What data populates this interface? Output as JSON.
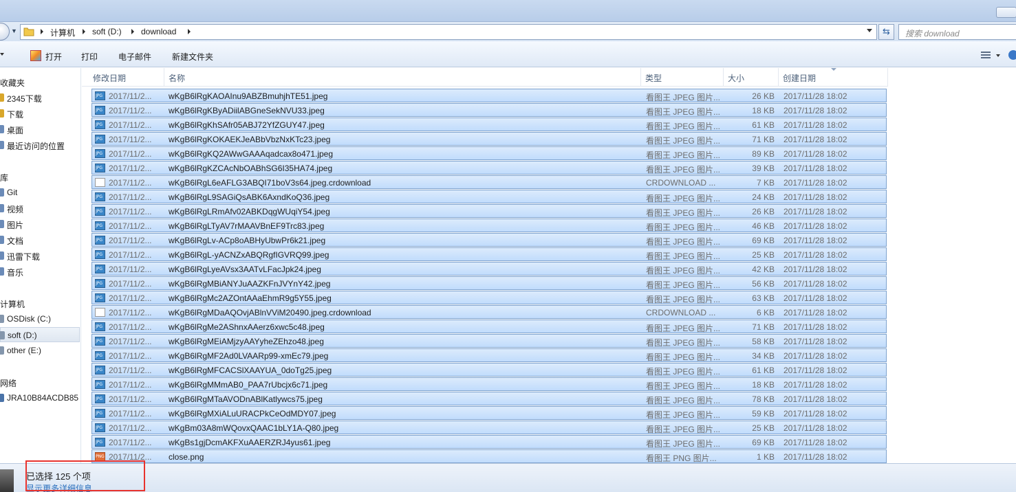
{
  "address": {
    "crumbs": [
      "计算机",
      "soft (D:)",
      "download"
    ],
    "search_placeholder": "搜索 download"
  },
  "toolbar": {
    "open": "打开",
    "print": "打印",
    "email": "电子邮件",
    "new_folder": "新建文件夹"
  },
  "sidebar": {
    "favorites": {
      "title": "收藏夹",
      "items": [
        {
          "label": "2345下载"
        },
        {
          "label": "下载"
        },
        {
          "label": "桌面"
        },
        {
          "label": "最近访问的位置"
        }
      ]
    },
    "libraries": {
      "title": "库",
      "items": [
        {
          "label": "Git"
        },
        {
          "label": "视频"
        },
        {
          "label": "图片"
        },
        {
          "label": "文档"
        },
        {
          "label": "迅雷下载"
        },
        {
          "label": "音乐"
        }
      ]
    },
    "computer": {
      "title": "计算机",
      "items": [
        {
          "label": "OSDisk (C:)"
        },
        {
          "label": "soft (D:)",
          "selected": true
        },
        {
          "label": "other (E:)"
        }
      ]
    },
    "network": {
      "title": "网络",
      "items": [
        {
          "label": "JRA10B84ACDB85"
        }
      ]
    }
  },
  "columns": {
    "modified": "修改日期",
    "name": "名称",
    "type": "类型",
    "size": "大小",
    "created": "创建日期"
  },
  "files": [
    {
      "icon": "jpg",
      "modified": "2017/11/2...",
      "name": "wKgB6lRgKAOAInu9ABZBmuhjhTE51.jpeg",
      "type": "看图王 JPEG 图片...",
      "size": "26 KB",
      "created": "2017/11/28 18:02"
    },
    {
      "icon": "jpg",
      "modified": "2017/11/2...",
      "name": "wKgB6lRgKByADiilABGneSekNVU33.jpeg",
      "type": "看图王 JPEG 图片...",
      "size": "18 KB",
      "created": "2017/11/28 18:02"
    },
    {
      "icon": "jpg",
      "modified": "2017/11/2...",
      "name": "wKgB6lRgKhSAfr05ABJ72YfZGUY47.jpeg",
      "type": "看图王 JPEG 图片...",
      "size": "61 KB",
      "created": "2017/11/28 18:02"
    },
    {
      "icon": "jpg",
      "modified": "2017/11/2...",
      "name": "wKgB6lRgKOKAEKJeABbVbzNxKTc23.jpeg",
      "type": "看图王 JPEG 图片...",
      "size": "71 KB",
      "created": "2017/11/28 18:02"
    },
    {
      "icon": "jpg",
      "modified": "2017/11/2...",
      "name": "wKgB6lRgKQ2AWwGAAAqadcax8o471.jpeg",
      "type": "看图王 JPEG 图片...",
      "size": "89 KB",
      "created": "2017/11/28 18:02"
    },
    {
      "icon": "jpg",
      "modified": "2017/11/2...",
      "name": "wKgB6lRgKZCAcNbOABhSG6I35HA74.jpeg",
      "type": "看图王 JPEG 图片...",
      "size": "39 KB",
      "created": "2017/11/28 18:02"
    },
    {
      "icon": "blank",
      "modified": "2017/11/2...",
      "name": "wKgB6lRgL6eAFLG3ABQI71boV3s64.jpeg.crdownload",
      "type": "CRDOWNLOAD ...",
      "size": "7 KB",
      "created": "2017/11/28 18:02"
    },
    {
      "icon": "jpg",
      "modified": "2017/11/2...",
      "name": "wKgB6lRgL9SAGiQsABK6AxndKoQ36.jpeg",
      "type": "看图王 JPEG 图片...",
      "size": "24 KB",
      "created": "2017/11/28 18:02"
    },
    {
      "icon": "jpg",
      "modified": "2017/11/2...",
      "name": "wKgB6lRgLRmAfv02ABKDqgWUqiY54.jpeg",
      "type": "看图王 JPEG 图片...",
      "size": "26 KB",
      "created": "2017/11/28 18:02"
    },
    {
      "icon": "jpg",
      "modified": "2017/11/2...",
      "name": "wKgB6lRgLTyAV7rMAAVBnEF9Trc83.jpeg",
      "type": "看图王 JPEG 图片...",
      "size": "46 KB",
      "created": "2017/11/28 18:02"
    },
    {
      "icon": "jpg",
      "modified": "2017/11/2...",
      "name": "wKgB6lRgLv-ACp8oABHyUbwPr6k21.jpeg",
      "type": "看图王 JPEG 图片...",
      "size": "69 KB",
      "created": "2017/11/28 18:02"
    },
    {
      "icon": "jpg",
      "modified": "2017/11/2...",
      "name": "wKgB6lRgL-yACNZxABQRgfIGVRQ99.jpeg",
      "type": "看图王 JPEG 图片...",
      "size": "25 KB",
      "created": "2017/11/28 18:02"
    },
    {
      "icon": "jpg",
      "modified": "2017/11/2...",
      "name": "wKgB6lRgLyeAVsx3AATvLFacJpk24.jpeg",
      "type": "看图王 JPEG 图片...",
      "size": "42 KB",
      "created": "2017/11/28 18:02"
    },
    {
      "icon": "jpg",
      "modified": "2017/11/2...",
      "name": "wKgB6lRgMBiANYJuAAZKFnJVYnY42.jpeg",
      "type": "看图王 JPEG 图片...",
      "size": "56 KB",
      "created": "2017/11/28 18:02"
    },
    {
      "icon": "jpg",
      "modified": "2017/11/2...",
      "name": "wKgB6lRgMc2AZOntAAaEhmR9g5Y55.jpeg",
      "type": "看图王 JPEG 图片...",
      "size": "63 KB",
      "created": "2017/11/28 18:02"
    },
    {
      "icon": "blank",
      "modified": "2017/11/2...",
      "name": "wKgB6lRgMDaAQOvjABlnVViM20490.jpeg.crdownload",
      "type": "CRDOWNLOAD ...",
      "size": "6 KB",
      "created": "2017/11/28 18:02"
    },
    {
      "icon": "jpg",
      "modified": "2017/11/2...",
      "name": "wKgB6lRgMe2AShnxAAerz6xwc5c48.jpeg",
      "type": "看图王 JPEG 图片...",
      "size": "71 KB",
      "created": "2017/11/28 18:02"
    },
    {
      "icon": "jpg",
      "modified": "2017/11/2...",
      "name": "wKgB6lRgMEiAMjzyAAYyheZEhzo48.jpeg",
      "type": "看图王 JPEG 图片...",
      "size": "58 KB",
      "created": "2017/11/28 18:02"
    },
    {
      "icon": "jpg",
      "modified": "2017/11/2...",
      "name": "wKgB6lRgMF2Ad0LVAARp99-xmEc79.jpeg",
      "type": "看图王 JPEG 图片...",
      "size": "34 KB",
      "created": "2017/11/28 18:02"
    },
    {
      "icon": "jpg",
      "modified": "2017/11/2...",
      "name": "wKgB6lRgMFCACSlXAAYUA_0doTg25.jpeg",
      "type": "看图王 JPEG 图片...",
      "size": "61 KB",
      "created": "2017/11/28 18:02"
    },
    {
      "icon": "jpg",
      "modified": "2017/11/2...",
      "name": "wKgB6lRgMMmAB0_PAA7rUbcjx6c71.jpeg",
      "type": "看图王 JPEG 图片...",
      "size": "18 KB",
      "created": "2017/11/28 18:02"
    },
    {
      "icon": "jpg",
      "modified": "2017/11/2...",
      "name": "wKgB6lRgMTaAVODnABlKatlywcs75.jpeg",
      "type": "看图王 JPEG 图片...",
      "size": "78 KB",
      "created": "2017/11/28 18:02"
    },
    {
      "icon": "jpg",
      "modified": "2017/11/2...",
      "name": "wKgB6lRgMXiALuURACPkCeOdMDY07.jpeg",
      "type": "看图王 JPEG 图片...",
      "size": "59 KB",
      "created": "2017/11/28 18:02"
    },
    {
      "icon": "jpg",
      "modified": "2017/11/2...",
      "name": "wKgBm03A8mWQovxQAAC1bLY1A-Q80.jpeg",
      "type": "看图王 JPEG 图片...",
      "size": "25 KB",
      "created": "2017/11/28 18:02"
    },
    {
      "icon": "jpg",
      "modified": "2017/11/2...",
      "name": "wKgBs1gjDcmAKFXuAAERZRJ4yus61.jpeg",
      "type": "看图王 JPEG 图片...",
      "size": "69 KB",
      "created": "2017/11/28 18:02"
    },
    {
      "icon": "png",
      "modified": "2017/11/2...",
      "name": "close.png",
      "type": "看图王 PNG 图片...",
      "size": "1 KB",
      "created": "2017/11/28 18:02"
    }
  ],
  "status": {
    "selected": "已选择 125 个项",
    "more_info": "显示更多详细信息..."
  },
  "colors": {
    "selection_fill": "#c9e0fc",
    "selection_border": "#7da2ce",
    "highlight_box": "#e8322d"
  }
}
